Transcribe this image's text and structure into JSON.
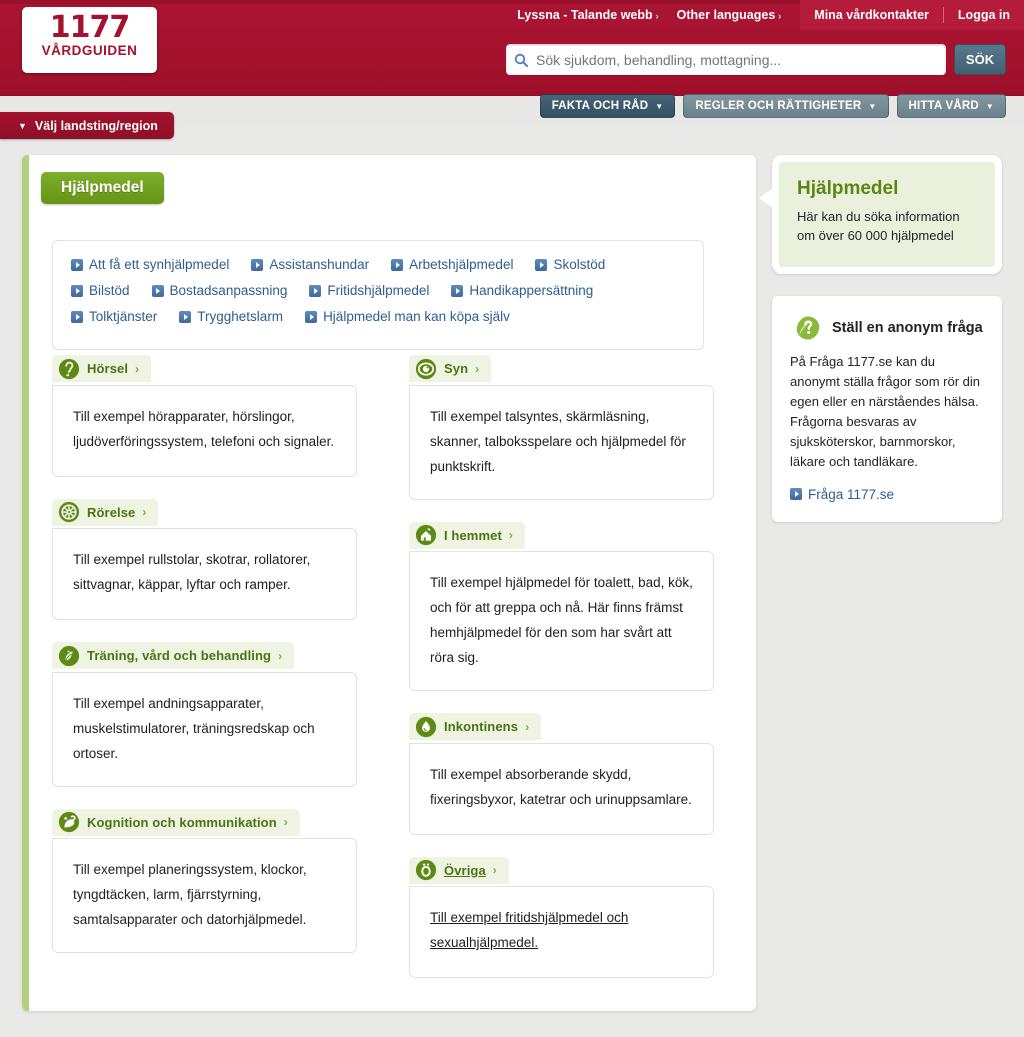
{
  "header": {
    "logo": {
      "number": "1177",
      "word": "VÅRDGUIDEN"
    },
    "utility_left": [
      {
        "label": "Lyssna - Talande webb",
        "chevron": "›"
      },
      {
        "label": "Other languages",
        "chevron": "›"
      }
    ],
    "utility_right": [
      {
        "label": "Mina vårdkontakter"
      },
      {
        "label": "Logga in"
      }
    ],
    "search": {
      "placeholder": "Sök sjukdom, behandling, mottagning...",
      "value": "",
      "button_label": "SÖK",
      "icon": "search-icon"
    },
    "nav_buttons": [
      {
        "label": "FAKTA OCH RÅD",
        "style": "dark",
        "icon": "chevron-down-icon"
      },
      {
        "label": "REGLER OCH RÄTTIGHETER",
        "style": "light",
        "icon": "chevron-down-icon"
      },
      {
        "label": "HITTA VÅRD",
        "style": "light",
        "icon": "chevron-down-icon"
      }
    ],
    "region_tab": {
      "label": "Välj landsting/region",
      "icon": "chevron-down-icon"
    },
    "colors": {
      "brand_red": "#a3122f",
      "brand_green": "#6fa01e",
      "nav_dark": "#3d5a6c"
    }
  },
  "main": {
    "page_tab_label": "Hjälpmedel",
    "quick_links": [
      "Att få ett synhjälpmedel",
      "Assistanshundar",
      "Arbetshjälpmedel",
      "Skolstöd",
      "Bilstöd",
      "Bostadsanpassning",
      "Fritidshjälpmedel",
      "Handikappersättning",
      "Tolktjänster",
      "Trygghetslarm",
      "Hjälpmedel man kan köpa själv"
    ],
    "categories_left": [
      {
        "title": "Hörsel",
        "icon": "ear-icon",
        "arrow": "›",
        "body": "Till exempel hörapparater, hörslingor, ljudöverföringssystem, telefoni och signaler.",
        "underlined": false
      },
      {
        "title": "Rörelse",
        "icon": "wheelchair-wheel-icon",
        "arrow": "›",
        "body": "Till exempel rullstolar, skotrar, rollatorer, sittvagnar, käppar, lyftar och ramper.",
        "underlined": false
      },
      {
        "title": "Träning, vård och behandling",
        "icon": "leaf-icon",
        "arrow": "›",
        "body": "Till exempel andningsapparater, muskelstimulatorer, träningsredskap och ortoser.",
        "underlined": false
      },
      {
        "title": "Kognition och kommunikation",
        "icon": "head-thought-icon",
        "arrow": "›",
        "body": "Till exempel planeringssystem, klockor, tyngdtäcken, larm, fjärrstyrning, samtalsapparater och datorhjälpmedel.",
        "underlined": false
      }
    ],
    "categories_right": [
      {
        "title": "Syn",
        "icon": "eye-icon",
        "arrow": "›",
        "body": "Till exempel talsyntes, skärmläsning, skanner, talboksspelare och hjälpmedel för punktskrift.",
        "underlined": false
      },
      {
        "title": "I hemmet",
        "icon": "house-icon",
        "arrow": "›",
        "body": "Till exempel hjälpmedel för toalett, bad, kök, och för att greppa och nå. Här finns främst hemhjälpmedel för den som har svårt att röra sig.",
        "underlined": false
      },
      {
        "title": "Inkontinens",
        "icon": "droplet-icon",
        "arrow": "›",
        "body": "Till exempel absorberande skydd, fixeringsbyxor, katetrar och urinuppsamlare.",
        "underlined": false
      },
      {
        "title": "Övriga",
        "icon": "oe-letter-icon",
        "arrow": "›",
        "body": "Till exempel fritidshjälpmedel och sexualhjälpmedel.",
        "underlined": true
      }
    ]
  },
  "aside": {
    "callout": {
      "title": "Hjälpmedel",
      "text": "Här kan du söka information om över 60 000 hjälpmedel"
    },
    "ask": {
      "icon": "question-leaf-icon",
      "title": "Ställ en anonym fråga",
      "text": "På Fråga 1177.se kan du anonymt ställa frågor som rör din egen eller en närståendes hälsa. Frågorna besvaras av sjuksköterskor, barnmorskor, läkare och tandläkare.",
      "link_label": "Fråga 1177.se"
    }
  }
}
